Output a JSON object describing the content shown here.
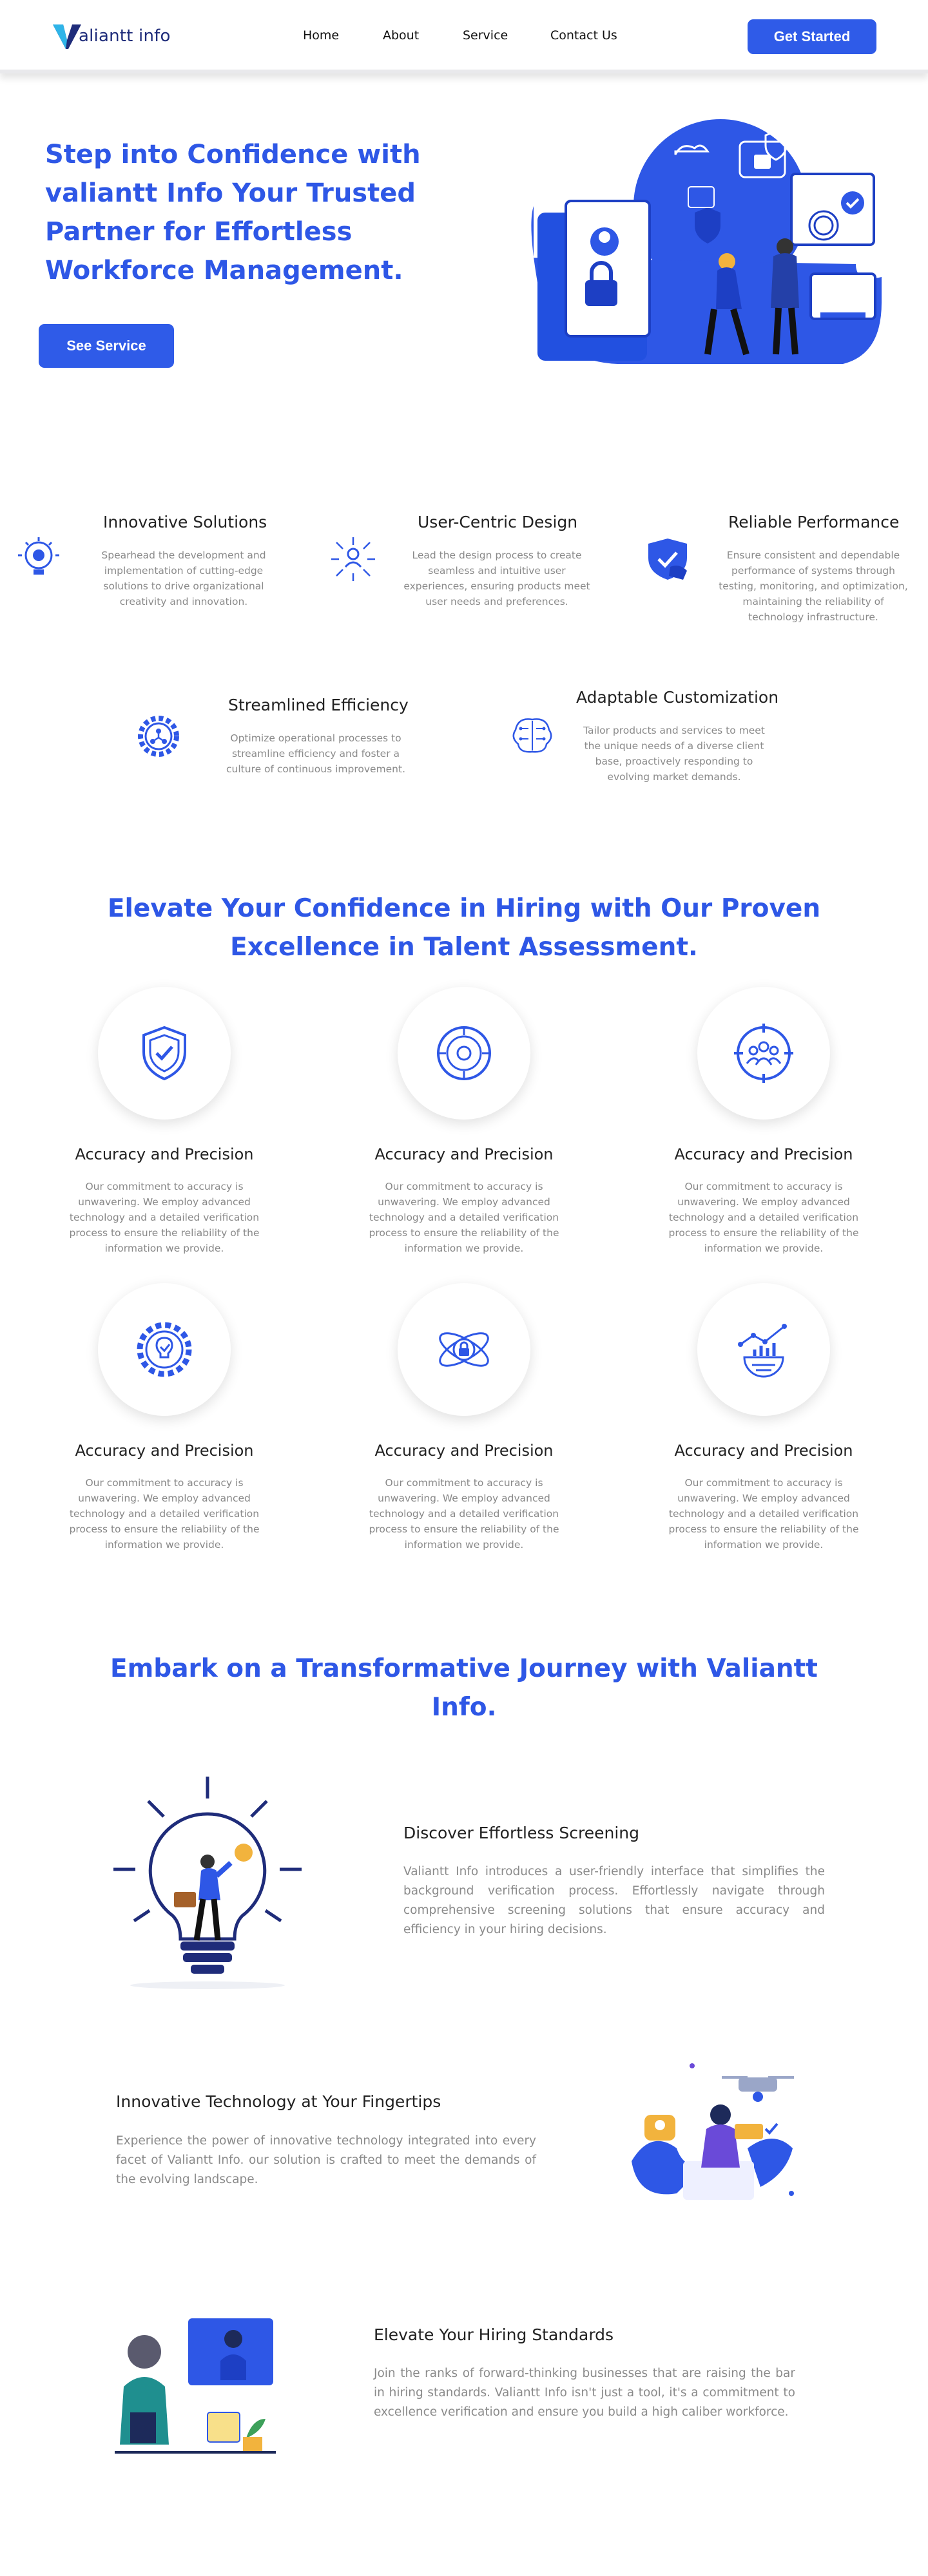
{
  "colors": {
    "accent": "#2e57e6",
    "button": "#2f5be8",
    "text": "#222222",
    "muted": "#8a8a8a"
  },
  "brand": {
    "logo_text": "aliantt info"
  },
  "nav": {
    "links": [
      "Home",
      "About",
      "Service",
      "Contact Us"
    ],
    "cta": "Get Started"
  },
  "hero": {
    "title": "Step into Confidence with valiantt Info Your Trusted Partner for Effortless Workforce Management.",
    "button": "See Service"
  },
  "features": [
    {
      "title": "Innovative Solutions",
      "desc": "Spearhead the development and implementation of cutting-edge solutions to drive organizational creativity and innovation.",
      "icon": "lightbulb-gear-icon"
    },
    {
      "title": "User-Centric Design",
      "desc": "Lead the design process to create seamless and intuitive user experiences, ensuring products meet user needs and preferences.",
      "icon": "user-network-icon"
    },
    {
      "title": "Reliable Performance",
      "desc": "Ensure consistent and dependable performance of systems through testing, monitoring, and optimization, maintaining the reliability of technology infrastructure.",
      "icon": "shield-hand-icon"
    },
    {
      "title": "Streamlined Efficiency",
      "desc": "Optimize operational processes to streamline efficiency and foster a culture of continuous improvement.",
      "icon": "gear-network-icon"
    },
    {
      "title": "Adaptable Customization",
      "desc": "Tailor products and services to meet the unique needs of a diverse client base, proactively responding to evolving market demands.",
      "icon": "brain-circuit-icon"
    }
  ],
  "section2": {
    "title": "Elevate Your Confidence in Hiring with Our Proven Excellence in Talent Assessment."
  },
  "cards": [
    {
      "title": "Accuracy and Precision",
      "desc": "Our commitment to accuracy is unwavering. We employ advanced technology and a detailed verification process to ensure the reliability of the information we provide.",
      "icon": "shield-check-icon"
    },
    {
      "title": "Accuracy and Precision",
      "desc": "Our commitment to accuracy is unwavering. We employ advanced technology and a detailed verification process to ensure the reliability of the information we provide.",
      "icon": "target-icon"
    },
    {
      "title": "Accuracy and Precision",
      "desc": "Our commitment to accuracy is unwavering. We employ advanced technology and a detailed verification process to ensure the reliability of the information we provide.",
      "icon": "team-target-icon"
    },
    {
      "title": "Accuracy and Precision",
      "desc": "Our commitment to accuracy is unwavering. We employ advanced technology and a detailed verification process to ensure the reliability of the information we provide.",
      "icon": "gear-bulb-icon"
    },
    {
      "title": "Accuracy and Precision",
      "desc": "Our commitment to accuracy is unwavering. We employ advanced technology and a detailed verification process to ensure the reliability of the information we provide.",
      "icon": "lock-orbit-icon"
    },
    {
      "title": "Accuracy and Precision",
      "desc": "Our commitment to accuracy is unwavering. We employ advanced technology and a detailed verification process to ensure the reliability of the information we provide.",
      "icon": "growth-chart-icon"
    }
  ],
  "section3": {
    "title": "Embark on a Transformative Journey with Valiantt Info."
  },
  "journey": [
    {
      "title": "Discover Effortless Screening",
      "desc": "Valiantt Info introduces a user-friendly interface that simplifies the background verification process. Effortlessly navigate through comprehensive screening solutions that ensure accuracy and efficiency in your hiring decisions."
    },
    {
      "title": "Innovative Technology at Your Fingertips",
      "desc": "Experience the power of innovative technology integrated into every facet of Valiantt Info. our solution is crafted to meet the demands of the evolving landscape."
    },
    {
      "title": "Elevate Your Hiring Standards",
      "desc": "Join the ranks of forward-thinking businesses that are raising the bar in hiring standards. Valiantt Info isn't just a tool, it's a commitment to excellence verification and ensure you build a high caliber workforce."
    }
  ]
}
